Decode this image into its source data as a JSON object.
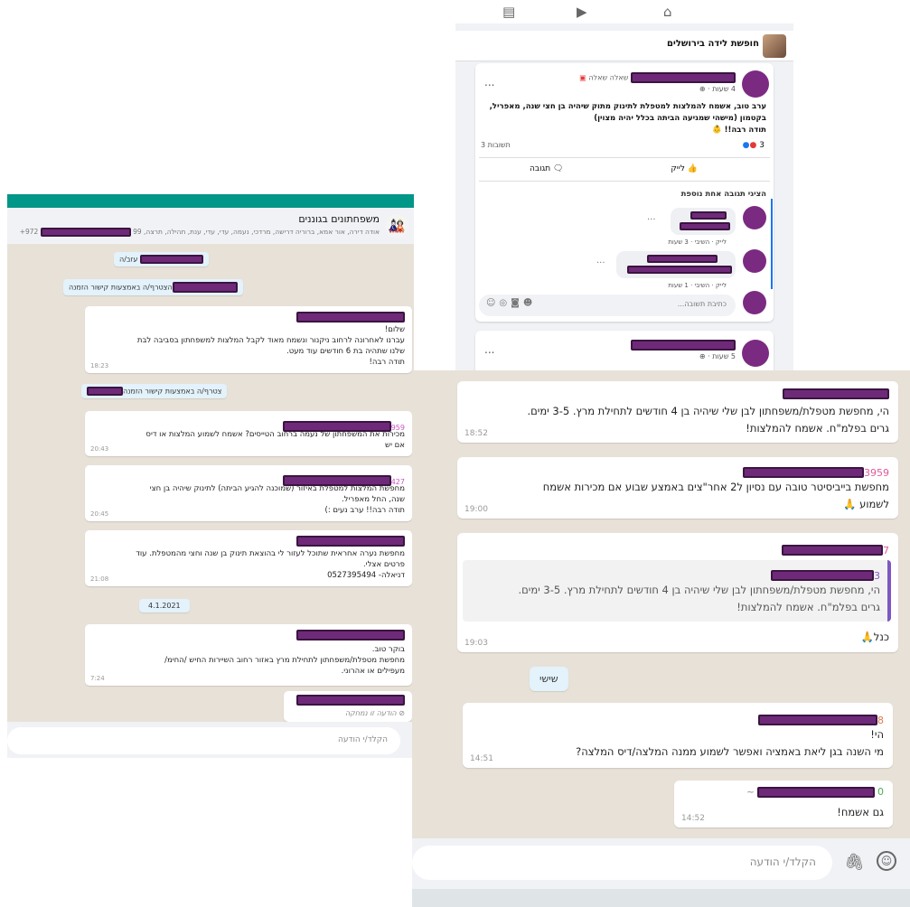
{
  "facebook": {
    "group_title": "חופשת לידה בירושלים",
    "post": {
      "badge": "שאלה שאלה",
      "time": "4 שעות ·",
      "text_line1": "ערב טוב, אשמח להמלצות למטפלת לתינוק מתוק שיהיה בן חצי שנה, מאפריל,",
      "text_line2": "בקטמון (מישהי שמגיעה הביתה בכלל יהיה מצוין)",
      "text_line3": "תודה רבה!!",
      "reactions_count": "3",
      "comments_count": "3 תשובות",
      "like_label": "לייק",
      "comment_label": "תגובה",
      "more_replies": "הציגי תגובה אחת נוספת",
      "reply1_meta": "לייק · השיבי · 3 שעות",
      "reply2_meta": "לייק · השיבי · 1 שעות",
      "write_reply": "כתיבת תשובה...",
      "more": "..."
    },
    "post2_time": "5 שעות ·",
    "post2_more": "..."
  },
  "wa_left": {
    "title": "משפחתונים בגוננים",
    "subtitle": "אודה דירה, אור אמא, ברוריה דרישה, מרדכי, נעמה, עדי, עדי, ענת, תהילה, תרצה, 99",
    "phone_prefix": "+972",
    "sys1": "עזב/ה",
    "sys2": "הצטרף/ה באמצעות קישור הזמנה",
    "sys3": "צטרף/ה באמצעות קישור הזמנה",
    "msg1": {
      "lines": [
        "שלום!",
        "עברנו לאחרונה לרחוב ניקנור ונשמח מאוד לקבל המלצות למשפחתון בסביבה לבת",
        "שלנו שתהיה בת 6 חודשים עוד מעט.",
        "תודה רבה!"
      ],
      "time": "18:23"
    },
    "msg2": {
      "num": "959",
      "lines": [
        "מכירות את המשפחתון של נעמה ברחוב הטייסים? אשמח לשמוע המלצות או דיס",
        "אם יש"
      ],
      "time": "20:43"
    },
    "msg3": {
      "num": "427",
      "lines": [
        "מחפשת המלצות למטפלת באיזור (שמוכנה להגיע הביתה) לתינוק שיהיה בן חצי",
        "שנה, החל מאפריל.",
        "תודה רבה!! ערב נעים :)"
      ],
      "time": "20:45"
    },
    "msg4": {
      "lines": [
        "מחפשת נערה אחראית שתוכל לעזור לי בהוצאת תינוק בן שנה וחצי מהמטפלת. עוד",
        "פרטים אצלי.",
        "דניאלה- 0527395494"
      ],
      "time": "21:08"
    },
    "date_chip": "4.1.2021",
    "msg5": {
      "lines": [
        "בוקר טוב.",
        "מחפשת מטפלת/משפחתון לתחילת מרץ באזור רחוב השיירות החיש /החימ/",
        "מעפילים או אהרוני."
      ],
      "time": "7:24"
    },
    "msg6": {
      "deleted": "הודעה זו נמחקה"
    },
    "input_placeholder": "הקלד/י הודעה"
  },
  "wa_right": {
    "msg1": {
      "lines": [
        "הי, מחפשת מטפלת/משפחתון לבן שלי שיהיה בן 4 חודשים לתחילת מרץ. 3-5 ימים.",
        "גרים בפלמ\"ח. אשמח להמלצות!"
      ],
      "time": "18:52"
    },
    "msg2": {
      "num": "3959",
      "lines": [
        "מחפשת בייביסיטר טובה עם נסיון ל2 אחר\"צים באמצע שבוע אם מכירות אשמח",
        "לשמוע 🙏"
      ],
      "time": "19:00"
    },
    "msg3": {
      "num": "7",
      "quote_num": "3",
      "quote_lines": [
        "הי, מחפשת מטפלת/משפחתון לבן שלי שיהיה בן 4 חודשים לתחילת מרץ. 3-5 ימים.",
        "גרים בפלמ\"ח. אשמח להמלצות!"
      ],
      "reply": "כנל🙏",
      "time": "19:03"
    },
    "day_chip": "שישי",
    "msg4": {
      "num": "8",
      "lines": [
        "הי!",
        "מי השנה בגן ליאת באמציה ואפשר לשמוע ממנה המלצה/דיס המלצה?"
      ],
      "time": "14:51"
    },
    "msg5": {
      "num": "0",
      "tilde": "~",
      "line": "גם אשמח!",
      "time": "14:52"
    },
    "input_placeholder": "הקלד/י הודעה"
  }
}
